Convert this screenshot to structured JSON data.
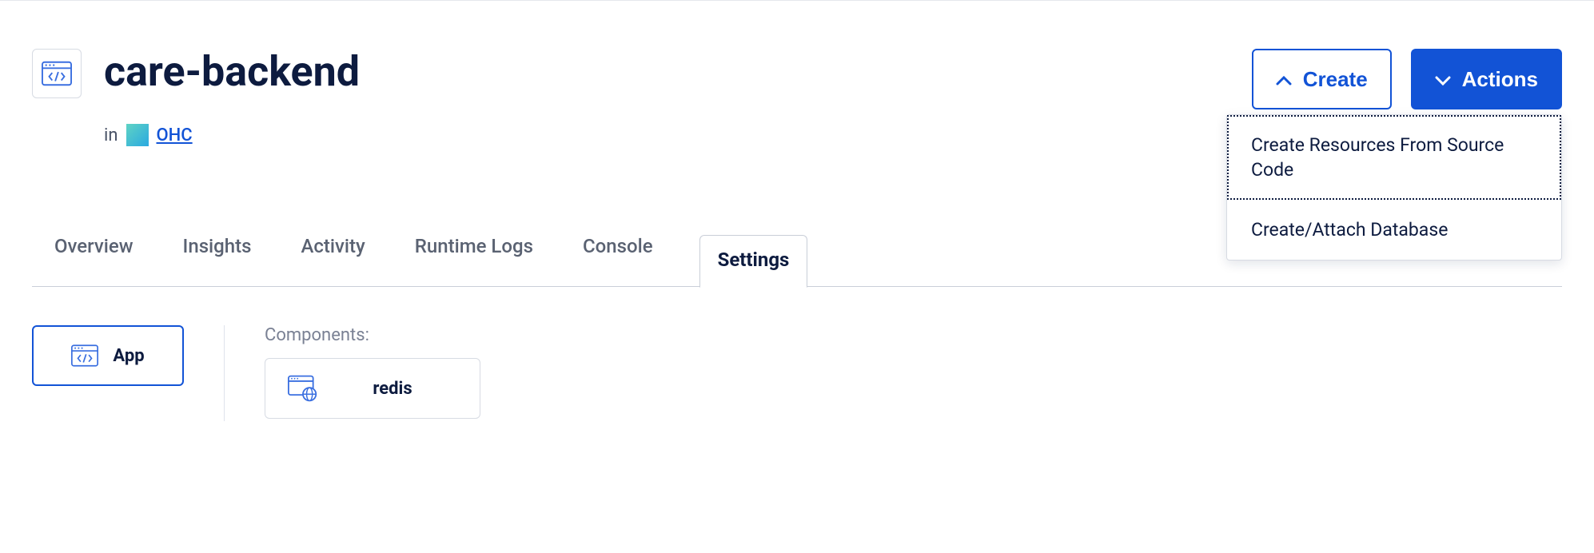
{
  "header": {
    "title": "care-backend",
    "in_label": "in",
    "project_name": "OHC"
  },
  "buttons": {
    "create": "Create",
    "actions": "Actions"
  },
  "create_menu": {
    "items": [
      {
        "label": "Create Resources From Source Code",
        "focused": true
      },
      {
        "label": "Create/Attach Database",
        "focused": false
      }
    ]
  },
  "tabs": [
    {
      "id": "overview",
      "label": "Overview",
      "active": false
    },
    {
      "id": "insights",
      "label": "Insights",
      "active": false
    },
    {
      "id": "activity",
      "label": "Activity",
      "active": false
    },
    {
      "id": "runtime-logs",
      "label": "Runtime Logs",
      "active": false
    },
    {
      "id": "console",
      "label": "Console",
      "active": false
    },
    {
      "id": "settings",
      "label": "Settings",
      "active": true
    }
  ],
  "content": {
    "app_card_label": "App",
    "components_label": "Components:",
    "components": [
      {
        "name": "redis"
      }
    ]
  }
}
